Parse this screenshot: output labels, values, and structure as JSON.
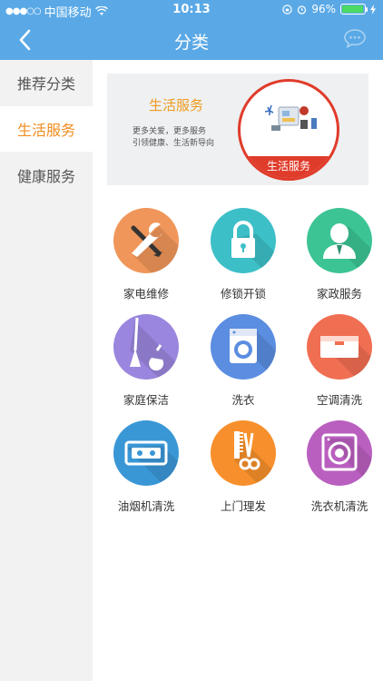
{
  "status_bar": {
    "carrier": "中国移动",
    "time": "10:13",
    "battery": "96%",
    "battery_level": 0.96
  },
  "nav": {
    "title": "分类"
  },
  "sidebar": {
    "items": [
      {
        "label": "推荐分类",
        "active": false
      },
      {
        "label": "生活服务",
        "active": true
      },
      {
        "label": "健康服务",
        "active": false
      }
    ]
  },
  "banner": {
    "title": "生活服务",
    "line1": "更多关爱，更多服务",
    "line2": "引领健康、生活新导向",
    "badge": "生活服务"
  },
  "services": [
    {
      "label": "家电维修",
      "icon": "wrench-screwdriver-icon",
      "color": "#f0965a"
    },
    {
      "label": "修锁开锁",
      "icon": "lock-icon",
      "color": "#3dbfc7"
    },
    {
      "label": "家政服务",
      "icon": "person-icon",
      "color": "#3cc494"
    },
    {
      "label": "家庭保洁",
      "icon": "broom-icon",
      "color": "#9a86de"
    },
    {
      "label": "洗衣",
      "icon": "washing-machine-icon",
      "color": "#5b8de0"
    },
    {
      "label": "空调清洗",
      "icon": "air-conditioner-icon",
      "color": "#f06e52"
    },
    {
      "label": "油烟机清洗",
      "icon": "range-hood-icon",
      "color": "#3a97d6"
    },
    {
      "label": "上门理发",
      "icon": "comb-scissors-icon",
      "color": "#f7902c"
    },
    {
      "label": "洗衣机清洗",
      "icon": "speaker-washer-icon",
      "color": "#b95fbf"
    }
  ]
}
